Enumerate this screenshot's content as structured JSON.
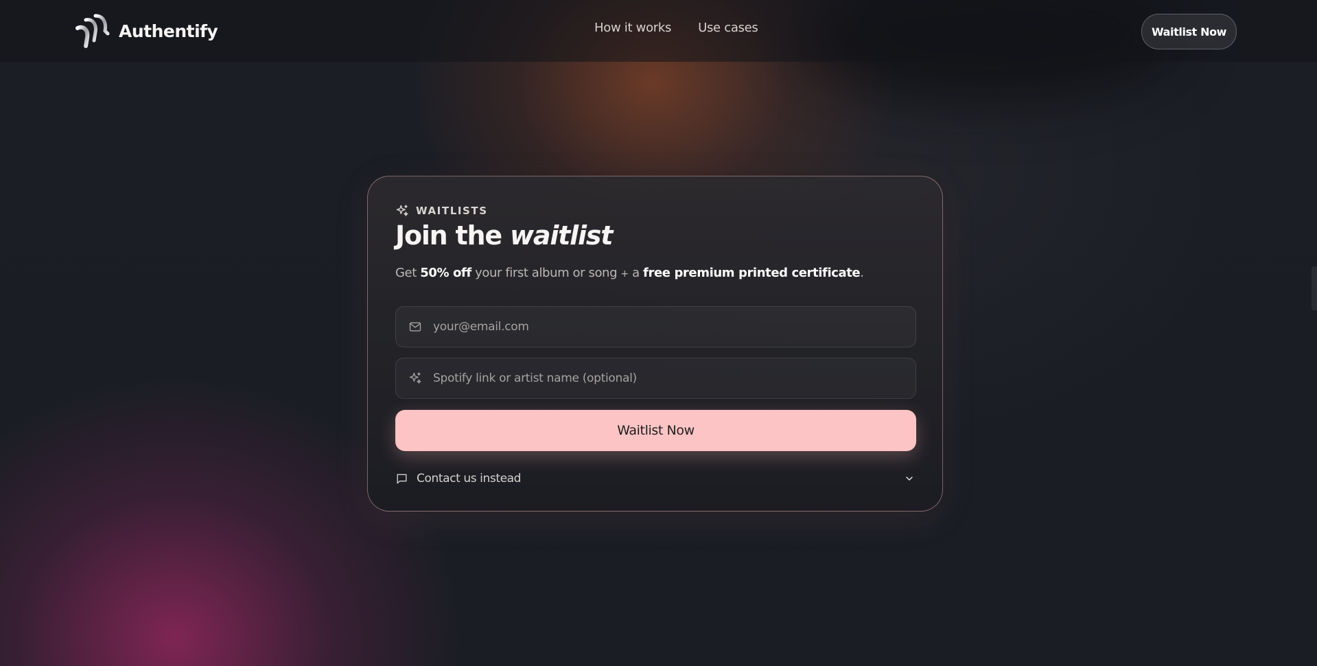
{
  "brand": {
    "name": "Authentify",
    "logo_icon": "authentify-logo-icon"
  },
  "nav": {
    "items": [
      {
        "label": "How it works"
      },
      {
        "label": "Use cases"
      }
    ],
    "cta_label": "Waitlist Now"
  },
  "card": {
    "eyebrow_icon": "sparkles-icon",
    "eyebrow": "WAITLISTS",
    "title_plain": "Join the ",
    "title_emphasis": "waitlist",
    "subtitle": {
      "part1": "Get ",
      "strong1": "50% off",
      "part2": " your first album or song ",
      "plus": "+",
      "part3": " a ",
      "strong2": "free premium printed certificate",
      "part4": "."
    },
    "email_field": {
      "icon": "mail-icon",
      "placeholder": "your@email.com",
      "value": ""
    },
    "artist_field": {
      "icon": "sparkles-icon",
      "placeholder": "Spotify link or artist name (optional)",
      "value": ""
    },
    "submit_label": "Waitlist Now",
    "contact": {
      "icon": "message-square-icon",
      "label": "Contact us instead",
      "toggle_icon": "chevron-down-icon"
    }
  },
  "colors": {
    "background": "#181b22",
    "accent_button": "#fcc4c4",
    "card_border": "#f0beb9",
    "glow_orange": "#aa5028",
    "glow_magenta": "#a02864"
  }
}
